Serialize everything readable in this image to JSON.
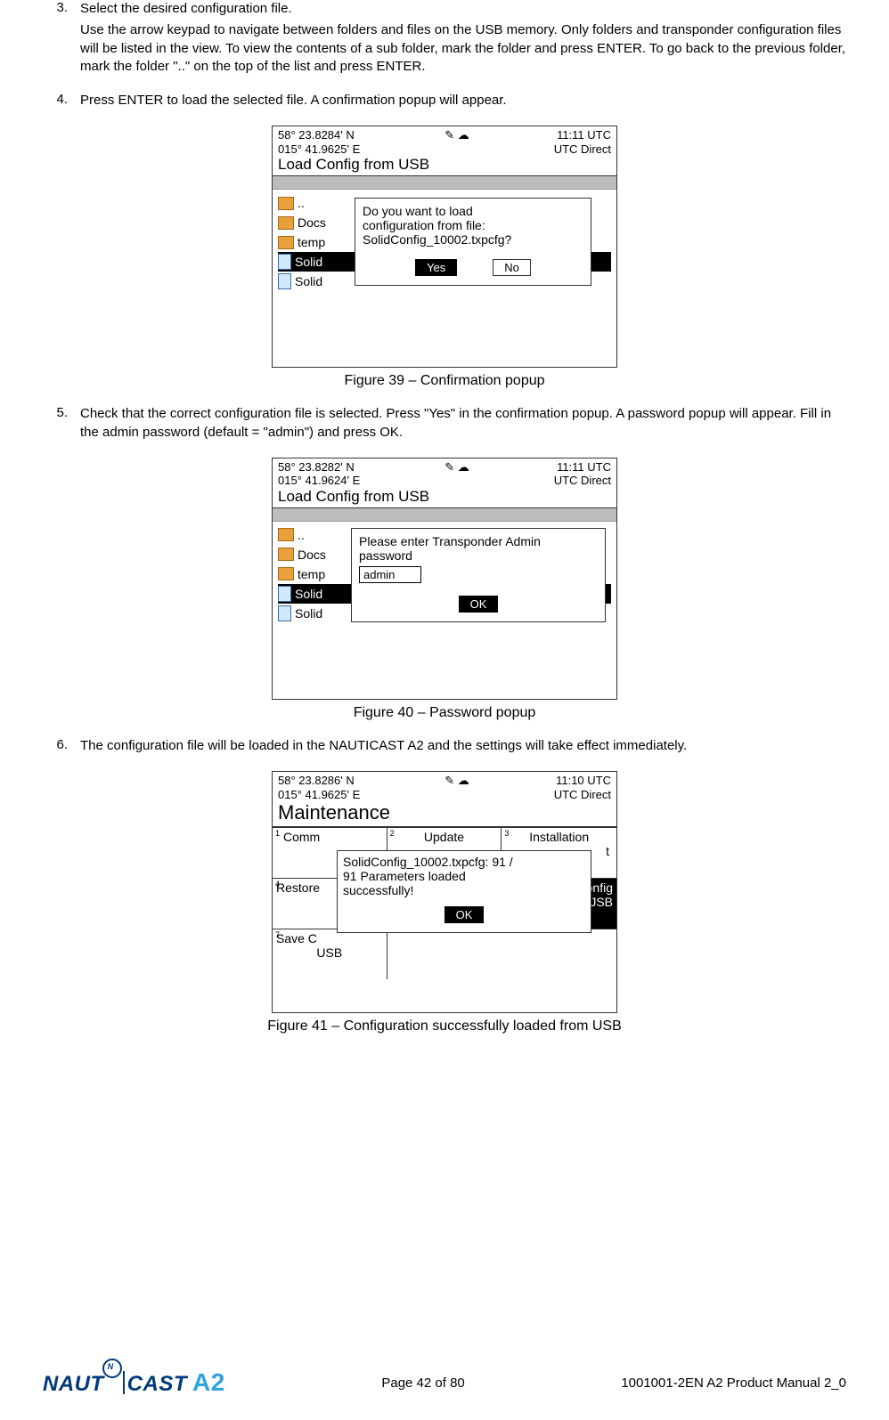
{
  "steps": {
    "s3": {
      "num": "3.",
      "title": "Select the desired configuration file.",
      "body": "Use the arrow keypad to navigate between folders and files on the USB memory. Only folders and transponder configuration files will be listed in the view. To view the contents of a sub folder, mark the folder and press ENTER. To go back to the previous folder, mark the folder \"..\" on the top of the list and press ENTER."
    },
    "s4": {
      "num": "4.",
      "body": "Press ENTER to load the selected file. A confirmation popup will appear."
    },
    "s5": {
      "num": "5.",
      "body": "Check that the correct configuration file is selected. Press \"Yes\" in the confirmation popup. A password popup will appear. Fill in the admin password (default = \"admin\") and press OK."
    },
    "s6": {
      "num": "6.",
      "body": "The configuration file will be loaded in the NAUTICAST A2 and the settings will take effect immediately."
    }
  },
  "captions": {
    "c39": "Figure 39 – Confirmation popup",
    "c40": "Figure 40 – Password popup",
    "c41": "Figure 41 – Configuration successfully loaded from USB"
  },
  "screen1": {
    "lat": "58° 23.8284' N",
    "lon": "015° 41.9625' E",
    "icons": "✎ ☁",
    "time": "11:11 UTC",
    "mode": "UTC Direct",
    "title": "Load Config from USB",
    "rows": {
      "r0": "..",
      "r1": "Docs",
      "r2": "temp",
      "r3": "Solid",
      "r4": "Solid"
    },
    "popup": {
      "l1": "Do you want to load",
      "l2": "configuration from file:",
      "l3": "SolidConfig_10002.txpcfg?",
      "yes": "Yes",
      "no": "No"
    }
  },
  "screen2": {
    "lat": "58° 23.8282' N",
    "lon": "015° 41.9624' E",
    "icons": "✎ ☁",
    "time": "11:11 UTC",
    "mode": "UTC Direct",
    "title": "Load Config from USB",
    "rows": {
      "r0": "..",
      "r1": "Docs",
      "r2": "temp",
      "r3": "Solid",
      "r4": "Solid"
    },
    "popup": {
      "l1": "Please enter Transponder Admin",
      "l2": "password",
      "input": "admin",
      "ok": "OK"
    }
  },
  "screen3": {
    "lat": "58° 23.8286' N",
    "lon": "015° 41.9625' E",
    "icons": "✎ ☁",
    "time": "11:10 UTC",
    "mode": "UTC Direct",
    "title": "Maintenance",
    "cells": {
      "c1": "Comm",
      "c2": "Update",
      "c3": "Installation",
      "c3b": "t",
      "c4": "Restore",
      "c6a": "onfig",
      "c6b": "JSB",
      "c7": "Save C",
      "c7b": "USB"
    },
    "popup": {
      "l1": "SolidConfig_10002.txpcfg: 91 /",
      "l2": "91 Parameters loaded",
      "l3": "successfully!",
      "ok": "OK"
    }
  },
  "footer": {
    "page": "Page 42 of 80",
    "doc": "1001001-2EN A2 Product Manual 2_0",
    "logo_naut": "NAUT",
    "logo_cast": "CAST",
    "logo_a2": "A2"
  }
}
